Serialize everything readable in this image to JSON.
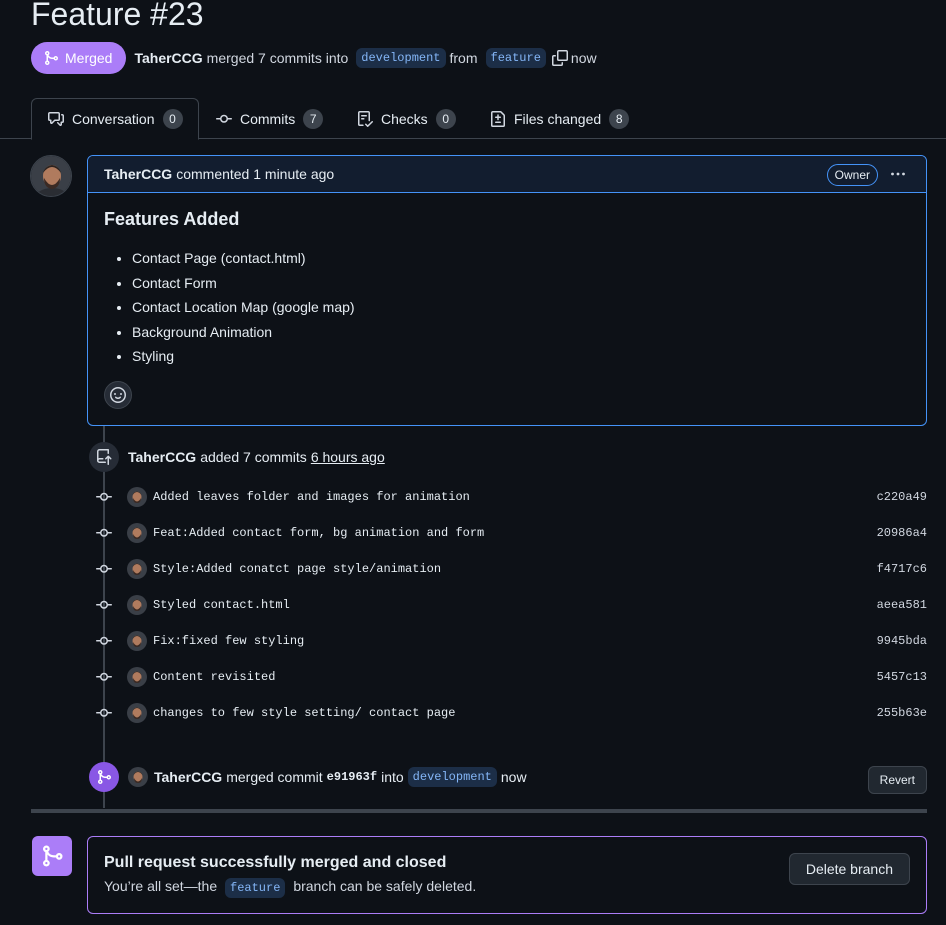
{
  "pr": {
    "title": "Feature #23",
    "state": "Merged",
    "author": "TaherCCG",
    "merged_text": "merged 7 commits into",
    "base_branch": "development",
    "from_text": "from",
    "head_branch": "feature",
    "time": "now"
  },
  "tabs": [
    {
      "label": "Conversation",
      "count": "0"
    },
    {
      "label": "Commits",
      "count": "7"
    },
    {
      "label": "Checks",
      "count": "0"
    },
    {
      "label": "Files changed",
      "count": "8"
    }
  ],
  "comment": {
    "author": "TaherCCG",
    "action": "commented 1 minute ago",
    "badge": "Owner",
    "heading": "Features Added",
    "items": [
      "Contact Page (contact.html)",
      "Contact Form",
      "Contact Location Map (google map)",
      "Background Animation",
      "Styling"
    ]
  },
  "commits_event": {
    "author": "TaherCCG",
    "text": "added 7 commits",
    "time": "6 hours ago"
  },
  "commits": [
    {
      "message": "Added leaves folder and images for animation",
      "sha": "c220a49"
    },
    {
      "message": "Feat:Added contact form, bg animation and form",
      "sha": "20986a4"
    },
    {
      "message": "Style:Added conatct page style/animation",
      "sha": "f4717c6"
    },
    {
      "message": "Styled contact.html",
      "sha": "aeea581"
    },
    {
      "message": "Fix:fixed few styling",
      "sha": "9945bda"
    },
    {
      "message": "Content revisited",
      "sha": "5457c13"
    },
    {
      "message": "changes to few style setting/ contact page",
      "sha": "255b63e"
    }
  ],
  "merge_event": {
    "author": "TaherCCG",
    "text": "merged commit",
    "sha": "e91963f",
    "into": "into",
    "branch": "development",
    "time": "now",
    "revert_label": "Revert"
  },
  "merged_box": {
    "title": "Pull request successfully merged and closed",
    "text_before": "You’re all set—the",
    "branch": "feature",
    "text_after": "branch can be safely deleted.",
    "delete_label": "Delete branch"
  },
  "colors": {
    "merged": "#ab7df8",
    "accent_blue": "#4493f8",
    "background": "#0d1117"
  }
}
